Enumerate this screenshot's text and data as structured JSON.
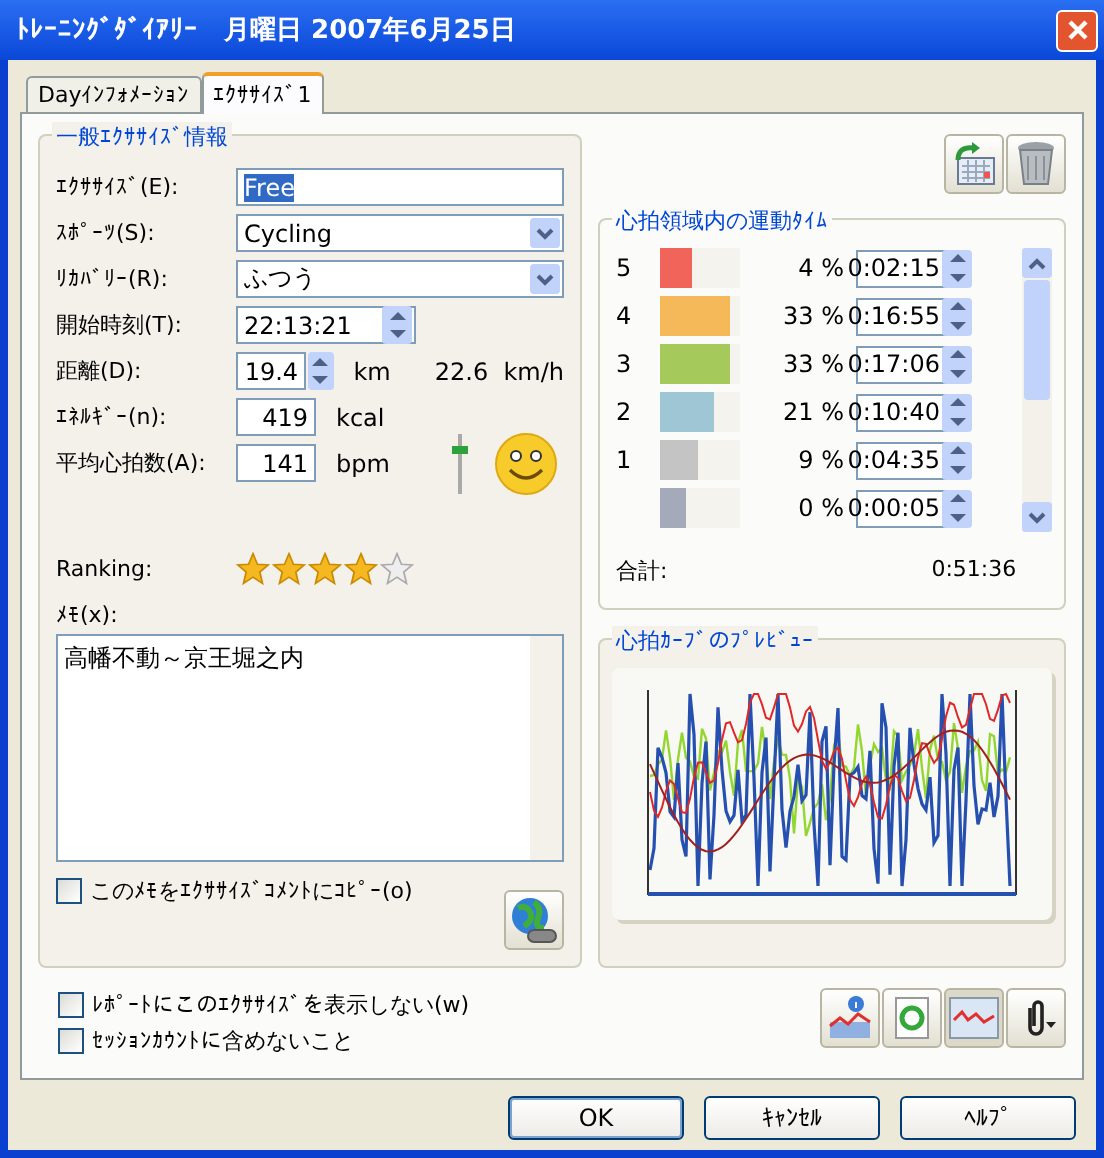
{
  "window": {
    "title": "ﾄﾚｰﾆﾝｸﾞﾀﾞｲｱﾘｰ　月曜日 2007年6月25日"
  },
  "tabs": [
    {
      "label": "Dayｲﾝﾌｫﾒｰｼｮﾝ",
      "selected": false
    },
    {
      "label": "ｴｸｻｻｲｽﾞ1",
      "selected": true
    }
  ],
  "general": {
    "title": "一般ｴｸｻｻｲｽﾞ情報",
    "fields": [
      {
        "kind": "text",
        "label": "ｴｸｻｻｲｽﾞ(E):",
        "value": "Free",
        "highlighted": true
      },
      {
        "kind": "select",
        "label": "ｽﾎﾟｰﾂ(S):",
        "value": "Cycling"
      },
      {
        "kind": "select",
        "label": "ﾘｶﾊﾞﾘｰ(R):",
        "value": "ふつう"
      },
      {
        "kind": "time",
        "label": "開始時刻(T):",
        "value": "22:13:21"
      },
      {
        "kind": "spin",
        "label": "距離(D):",
        "value": "19.4",
        "unit": "km",
        "extra": "22.6  km/h"
      },
      {
        "kind": "number",
        "label": "ｴﾈﾙｷﾞｰ(n):",
        "value": "419",
        "unit": "kcal"
      },
      {
        "kind": "number",
        "label": "平均心拍数(A):",
        "value": "141",
        "unit": "bpm"
      }
    ],
    "feeling": {
      "level": 0.75
    },
    "ranking": {
      "label": "Ranking:",
      "stars": 4
    },
    "memo": {
      "label": "ﾒﾓ(x):",
      "value": "高幡不動～京王堀之内"
    },
    "copy_memo": {
      "label": "このﾒﾓをｴｸｻｻｲｽﾞｺﾒﾝﾄにｺﾋﾟｰ(o)",
      "checked": false
    }
  },
  "zones": {
    "title": "心拍領域内の運動ﾀｲﾑ",
    "rows": [
      {
        "label": "5",
        "color": "#f0645a",
        "level": 0.4,
        "percent": "4 %",
        "time": "0:02:15"
      },
      {
        "label": "4",
        "color": "#f5b95a",
        "level": 0.88,
        "percent": "33 %",
        "time": "0:16:55"
      },
      {
        "label": "3",
        "color": "#a5c95a",
        "level": 0.88,
        "percent": "33 %",
        "time": "0:17:06"
      },
      {
        "label": "2",
        "color": "#9fc6d4",
        "level": 0.68,
        "percent": "21 %",
        "time": "0:10:40"
      },
      {
        "label": "1",
        "color": "#c4c4c4",
        "level": 0.48,
        "percent": "9 %",
        "time": "0:04:35"
      },
      {
        "label": "",
        "color": "#a5aabb",
        "level": 0.33,
        "percent": "0 %",
        "time": "0:00:05"
      }
    ],
    "total_label": "合計:",
    "total": "0:51:36"
  },
  "preview": {
    "title": "心拍ｶｰﾌﾞのﾌﾟﾚﾋﾞｭｰ"
  },
  "options": [
    {
      "label": "ﾚﾎﾟｰﾄにこのｴｸｻｻｲｽﾞを表示しない(w)",
      "checked": false
    },
    {
      "label": "ｾｯｼｮﾝｶｳﾝﾄに含めないこと",
      "checked": false
    }
  ],
  "buttons": [
    {
      "label": "OK",
      "default": true
    },
    {
      "label": "ｷｬﾝｾﾙ",
      "default": false
    },
    {
      "label": "ﾍﾙﾌﾟ",
      "default": false
    }
  ]
}
